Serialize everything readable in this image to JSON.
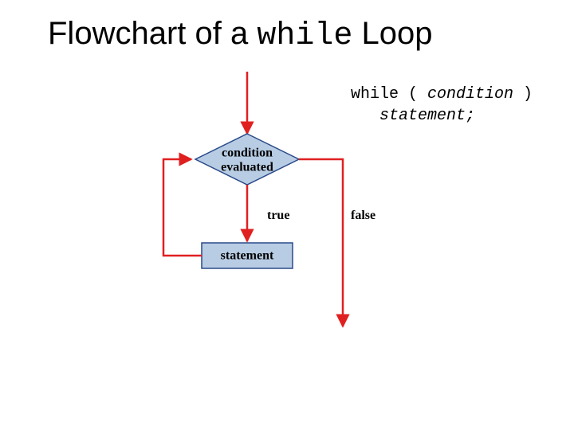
{
  "title": {
    "prefix": "Flowchart of a ",
    "mono": "while",
    "suffix": " Loop"
  },
  "code": {
    "line1_kw": "while ( ",
    "line1_cond": "condition",
    "line1_end": " )",
    "line2_indent": "   ",
    "line2_stmt": "statement;"
  },
  "diamond": {
    "line1": "condition",
    "line2": "evaluated"
  },
  "branches": {
    "true": "true",
    "false": "false"
  },
  "statement_box": "statement"
}
